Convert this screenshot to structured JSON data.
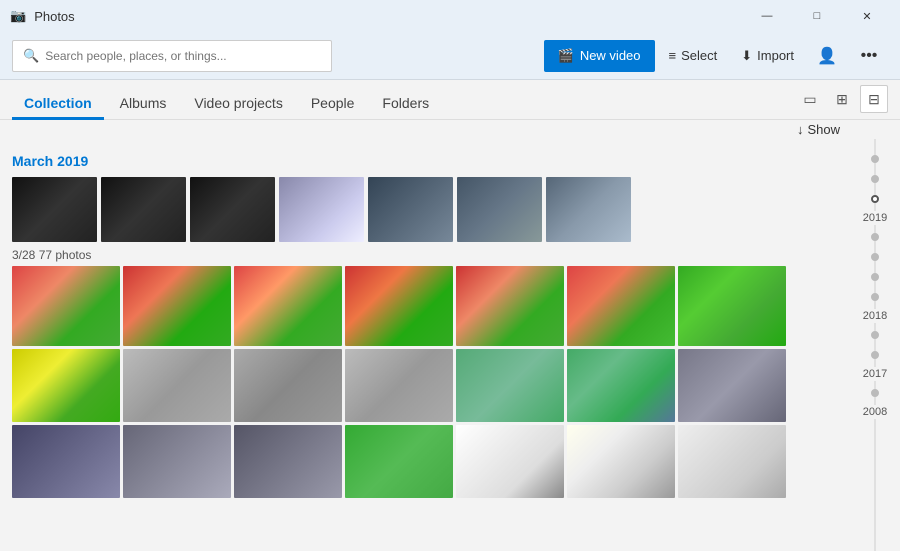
{
  "app": {
    "title": "Photos",
    "icon": "📷"
  },
  "titlebar": {
    "minimize_label": "—",
    "maximize_label": "□",
    "close_label": "✕"
  },
  "toolbar": {
    "search_placeholder": "Search people, places, or things...",
    "new_video_label": "New video",
    "select_label": "Select",
    "import_label": "Import",
    "more_label": "•••"
  },
  "nav": {
    "tabs": [
      {
        "id": "collection",
        "label": "Collection",
        "active": true
      },
      {
        "id": "albums",
        "label": "Albums",
        "active": false
      },
      {
        "id": "video-projects",
        "label": "Video projects",
        "active": false
      },
      {
        "id": "people",
        "label": "People",
        "active": false
      },
      {
        "id": "folders",
        "label": "Folders",
        "active": false
      }
    ],
    "show_label": "Show"
  },
  "main": {
    "section_date": "March 2019",
    "row_label": "3/28   77 photos",
    "timeline": {
      "years": [
        "2019",
        "2018",
        "2017",
        "2008"
      ]
    }
  }
}
